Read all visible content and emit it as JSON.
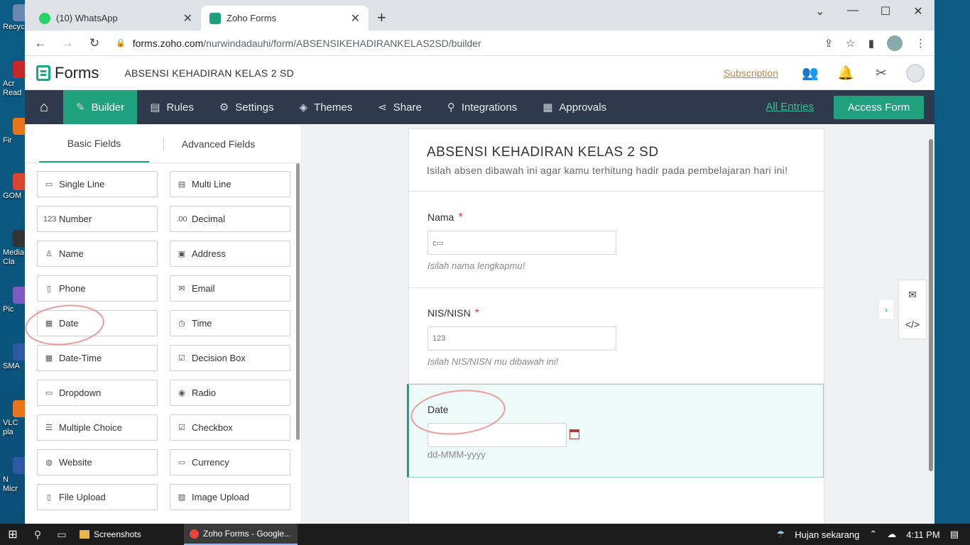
{
  "desktop": {
    "icons": [
      {
        "label": "Recyc",
        "color": "#6a87b0"
      },
      {
        "label": "Acr",
        "label2": "Read",
        "color": "#c62828"
      },
      {
        "label": "Fir",
        "color": "#e8741c"
      },
      {
        "label": "GOM",
        "color": "#d9452f"
      },
      {
        "label": "Media",
        "label2": "Cla",
        "color": "#333"
      },
      {
        "label": "Pic",
        "color": "#7b5cc4"
      },
      {
        "label": "SMA",
        "color": "#2d5aa5"
      },
      {
        "label": "VLC",
        "label2": "pla",
        "color": "#e8741c"
      },
      {
        "label": "N",
        "label2": "Micr",
        "color": "#2d5aa5"
      }
    ]
  },
  "browser": {
    "tabs": [
      {
        "title": "(10) WhatsApp",
        "favicon_color": "#25d366",
        "active": false
      },
      {
        "title": "Zoho Forms",
        "favicon_color": "#1fa17e",
        "active": true
      }
    ],
    "new_tab": "+",
    "url_host": "forms.zoho.com",
    "url_path": "/nurwindadauhi/form/ABSENSIKEHADIRANKELAS2SD/builder"
  },
  "app": {
    "brand": "Forms",
    "form_name": "ABSENSI KEHADIRAN KELAS 2 SD",
    "subscription": "Subscription",
    "nav": [
      {
        "label": "Builder",
        "icon": "builder-icon",
        "active": true
      },
      {
        "label": "Rules",
        "icon": "rules-icon",
        "active": false
      },
      {
        "label": "Settings",
        "icon": "gear-icon",
        "active": false
      },
      {
        "label": "Themes",
        "icon": "themes-icon",
        "active": false
      },
      {
        "label": "Share",
        "icon": "share-icon",
        "active": false
      },
      {
        "label": "Integrations",
        "icon": "integrations-icon",
        "active": false
      },
      {
        "label": "Approvals",
        "icon": "approvals-icon",
        "active": false
      }
    ],
    "all_entries": "All Entries",
    "access_form": "Access Form"
  },
  "fields_panel": {
    "tabs": [
      "Basic Fields",
      "Advanced Fields"
    ],
    "fields": [
      {
        "label": "Single Line",
        "icon": "single-line-icon",
        "glyph": "▭"
      },
      {
        "label": "Multi Line",
        "icon": "multi-line-icon",
        "glyph": "▤"
      },
      {
        "label": "Number",
        "icon": "number-icon",
        "glyph": "123"
      },
      {
        "label": "Decimal",
        "icon": "decimal-icon",
        "glyph": ".00"
      },
      {
        "label": "Name",
        "icon": "person-icon",
        "glyph": "♙"
      },
      {
        "label": "Address",
        "icon": "address-icon",
        "glyph": "▣"
      },
      {
        "label": "Phone",
        "icon": "phone-icon",
        "glyph": "▯"
      },
      {
        "label": "Email",
        "icon": "mail-icon",
        "glyph": "✉"
      },
      {
        "label": "Date",
        "icon": "calendar-icon",
        "glyph": "▦"
      },
      {
        "label": "Time",
        "icon": "clock-icon",
        "glyph": "◷"
      },
      {
        "label": "Date-Time",
        "icon": "date-time-icon",
        "glyph": "▦"
      },
      {
        "label": "Decision Box",
        "icon": "checkbox-icon",
        "glyph": "☑"
      },
      {
        "label": "Dropdown",
        "icon": "dropdown-icon",
        "glyph": "▭"
      },
      {
        "label": "Radio",
        "icon": "radio-icon",
        "glyph": "◉"
      },
      {
        "label": "Multiple Choice",
        "icon": "multiple-choice-icon",
        "glyph": "☰"
      },
      {
        "label": "Checkbox",
        "icon": "checkbox-list-icon",
        "glyph": "☑"
      },
      {
        "label": "Website",
        "icon": "globe-icon",
        "glyph": "◍"
      },
      {
        "label": "Currency",
        "icon": "currency-icon",
        "glyph": "▭"
      },
      {
        "label": "File Upload",
        "icon": "file-upload-icon",
        "glyph": "▯"
      },
      {
        "label": "Image Upload",
        "icon": "image-upload-icon",
        "glyph": "▨"
      }
    ]
  },
  "form": {
    "title": "ABSENSI KEHADIRAN KELAS 2 SD",
    "description": "Isilah absen dibawah ini agar kamu terhitung hadir pada pembelajaran hari ini!",
    "fields": [
      {
        "label": "Nama",
        "required_mark": "*",
        "placeholder_icon": "c▭",
        "hint": "Isilah nama lengkapmu!"
      },
      {
        "label": "NIS/NISN",
        "required_mark": "*",
        "placeholder_icon": "123",
        "hint": "Isilah NIS/NISN mu dibawah ini!"
      },
      {
        "label": "Date",
        "format": "dd-MMM-yyyy"
      }
    ]
  },
  "taskbar": {
    "apps": [
      {
        "label": "Screenshots",
        "active": false
      },
      {
        "label": "Zoho Forms - Google...",
        "active": true
      }
    ],
    "weather": "Hujan sekarang",
    "time": "4:11 PM"
  }
}
